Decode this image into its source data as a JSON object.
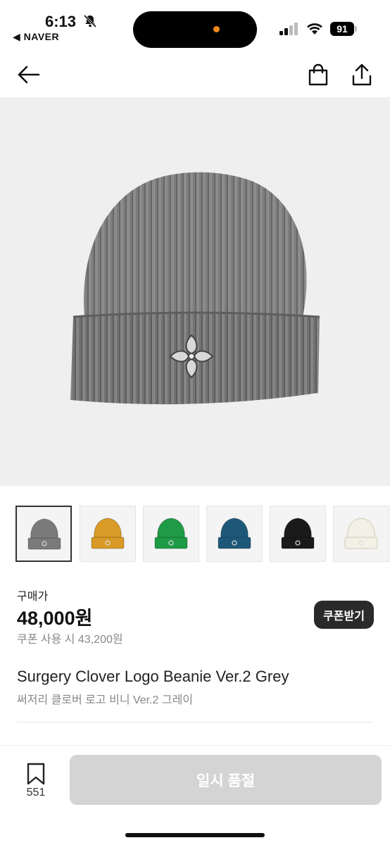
{
  "status_bar": {
    "time": "6:13",
    "back_app": "◀ NAVER",
    "battery": "91",
    "icons": [
      "bell-muted-icon",
      "signal-icon",
      "wifi-icon",
      "battery-icon"
    ]
  },
  "nav": {
    "icons": [
      "back-arrow-icon",
      "shopping-bag-icon",
      "share-icon"
    ]
  },
  "thumbnails": [
    {
      "color_name": "grey",
      "color": "#7a7a7a",
      "selected": true
    },
    {
      "color_name": "mustard",
      "color": "#d99a26",
      "selected": false
    },
    {
      "color_name": "green",
      "color": "#1f9a46",
      "selected": false
    },
    {
      "color_name": "teal",
      "color": "#1e5878",
      "selected": false
    },
    {
      "color_name": "black",
      "color": "#1a1a1a",
      "selected": false
    },
    {
      "color_name": "ivory",
      "color": "#f3f1e6",
      "selected": false
    }
  ],
  "price": {
    "label": "구매가",
    "amount": "48,000원",
    "coupon_price": "쿠폰 사용 시 43,200원",
    "coupon_button": "쿠폰받기"
  },
  "product": {
    "title_en": "Surgery Clover Logo Beanie Ver.2 Grey",
    "title_ko": "써저리 클로버 로고 비니 Ver.2 그레이"
  },
  "bottom_bar": {
    "wish_count": "551",
    "sold_out_label": "일시 품절"
  },
  "colors": {
    "accent_dark": "#2a2a2a",
    "disabled_button": "#d4d4d4",
    "hero_background": "#efefef"
  }
}
